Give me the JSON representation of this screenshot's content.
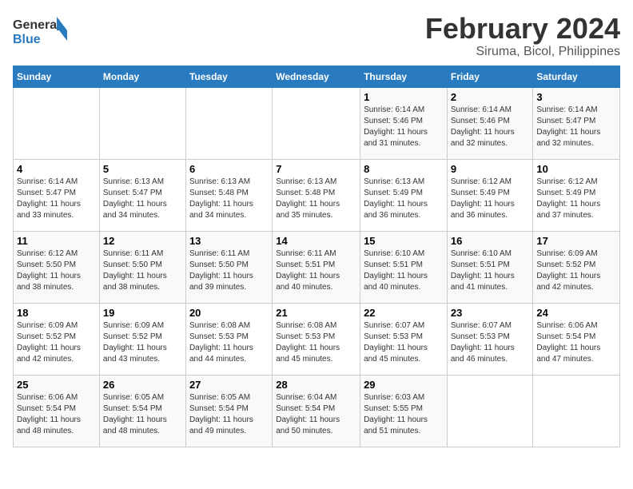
{
  "logo": {
    "text_general": "General",
    "text_blue": "Blue"
  },
  "title": "February 2024",
  "subtitle": "Siruma, Bicol, Philippines",
  "days_of_week": [
    "Sunday",
    "Monday",
    "Tuesday",
    "Wednesday",
    "Thursday",
    "Friday",
    "Saturday"
  ],
  "weeks": [
    [
      {
        "day": "",
        "info": ""
      },
      {
        "day": "",
        "info": ""
      },
      {
        "day": "",
        "info": ""
      },
      {
        "day": "",
        "info": ""
      },
      {
        "day": "1",
        "info": "Sunrise: 6:14 AM\nSunset: 5:46 PM\nDaylight: 11 hours\nand 31 minutes."
      },
      {
        "day": "2",
        "info": "Sunrise: 6:14 AM\nSunset: 5:46 PM\nDaylight: 11 hours\nand 32 minutes."
      },
      {
        "day": "3",
        "info": "Sunrise: 6:14 AM\nSunset: 5:47 PM\nDaylight: 11 hours\nand 32 minutes."
      }
    ],
    [
      {
        "day": "4",
        "info": "Sunrise: 6:14 AM\nSunset: 5:47 PM\nDaylight: 11 hours\nand 33 minutes."
      },
      {
        "day": "5",
        "info": "Sunrise: 6:13 AM\nSunset: 5:47 PM\nDaylight: 11 hours\nand 34 minutes."
      },
      {
        "day": "6",
        "info": "Sunrise: 6:13 AM\nSunset: 5:48 PM\nDaylight: 11 hours\nand 34 minutes."
      },
      {
        "day": "7",
        "info": "Sunrise: 6:13 AM\nSunset: 5:48 PM\nDaylight: 11 hours\nand 35 minutes."
      },
      {
        "day": "8",
        "info": "Sunrise: 6:13 AM\nSunset: 5:49 PM\nDaylight: 11 hours\nand 36 minutes."
      },
      {
        "day": "9",
        "info": "Sunrise: 6:12 AM\nSunset: 5:49 PM\nDaylight: 11 hours\nand 36 minutes."
      },
      {
        "day": "10",
        "info": "Sunrise: 6:12 AM\nSunset: 5:49 PM\nDaylight: 11 hours\nand 37 minutes."
      }
    ],
    [
      {
        "day": "11",
        "info": "Sunrise: 6:12 AM\nSunset: 5:50 PM\nDaylight: 11 hours\nand 38 minutes."
      },
      {
        "day": "12",
        "info": "Sunrise: 6:11 AM\nSunset: 5:50 PM\nDaylight: 11 hours\nand 38 minutes."
      },
      {
        "day": "13",
        "info": "Sunrise: 6:11 AM\nSunset: 5:50 PM\nDaylight: 11 hours\nand 39 minutes."
      },
      {
        "day": "14",
        "info": "Sunrise: 6:11 AM\nSunset: 5:51 PM\nDaylight: 11 hours\nand 40 minutes."
      },
      {
        "day": "15",
        "info": "Sunrise: 6:10 AM\nSunset: 5:51 PM\nDaylight: 11 hours\nand 40 minutes."
      },
      {
        "day": "16",
        "info": "Sunrise: 6:10 AM\nSunset: 5:51 PM\nDaylight: 11 hours\nand 41 minutes."
      },
      {
        "day": "17",
        "info": "Sunrise: 6:09 AM\nSunset: 5:52 PM\nDaylight: 11 hours\nand 42 minutes."
      }
    ],
    [
      {
        "day": "18",
        "info": "Sunrise: 6:09 AM\nSunset: 5:52 PM\nDaylight: 11 hours\nand 42 minutes."
      },
      {
        "day": "19",
        "info": "Sunrise: 6:09 AM\nSunset: 5:52 PM\nDaylight: 11 hours\nand 43 minutes."
      },
      {
        "day": "20",
        "info": "Sunrise: 6:08 AM\nSunset: 5:53 PM\nDaylight: 11 hours\nand 44 minutes."
      },
      {
        "day": "21",
        "info": "Sunrise: 6:08 AM\nSunset: 5:53 PM\nDaylight: 11 hours\nand 45 minutes."
      },
      {
        "day": "22",
        "info": "Sunrise: 6:07 AM\nSunset: 5:53 PM\nDaylight: 11 hours\nand 45 minutes."
      },
      {
        "day": "23",
        "info": "Sunrise: 6:07 AM\nSunset: 5:53 PM\nDaylight: 11 hours\nand 46 minutes."
      },
      {
        "day": "24",
        "info": "Sunrise: 6:06 AM\nSunset: 5:54 PM\nDaylight: 11 hours\nand 47 minutes."
      }
    ],
    [
      {
        "day": "25",
        "info": "Sunrise: 6:06 AM\nSunset: 5:54 PM\nDaylight: 11 hours\nand 48 minutes."
      },
      {
        "day": "26",
        "info": "Sunrise: 6:05 AM\nSunset: 5:54 PM\nDaylight: 11 hours\nand 48 minutes."
      },
      {
        "day": "27",
        "info": "Sunrise: 6:05 AM\nSunset: 5:54 PM\nDaylight: 11 hours\nand 49 minutes."
      },
      {
        "day": "28",
        "info": "Sunrise: 6:04 AM\nSunset: 5:54 PM\nDaylight: 11 hours\nand 50 minutes."
      },
      {
        "day": "29",
        "info": "Sunrise: 6:03 AM\nSunset: 5:55 PM\nDaylight: 11 hours\nand 51 minutes."
      },
      {
        "day": "",
        "info": ""
      },
      {
        "day": "",
        "info": ""
      }
    ]
  ]
}
